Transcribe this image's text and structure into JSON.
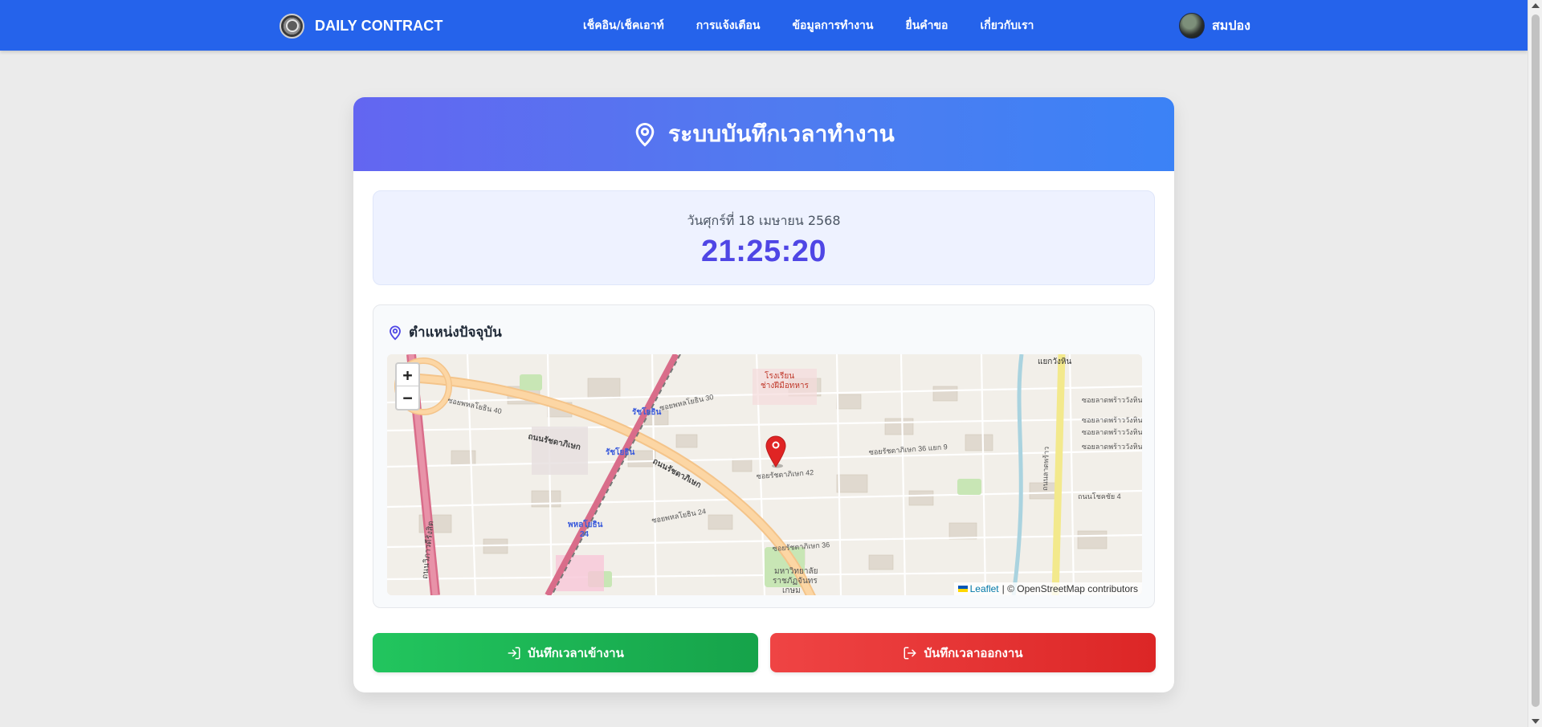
{
  "navbar": {
    "brand": "DAILY CONTRACT",
    "items": [
      {
        "label": "เช็คอิน/เช็คเอาท์"
      },
      {
        "label": "การแจ้งเตือน"
      },
      {
        "label": "ข้อมูลการทำงาน"
      },
      {
        "label": "ยื่นคำขอ"
      },
      {
        "label": "เกี่ยวกับเรา"
      }
    ],
    "user_name": "สมปอง"
  },
  "card": {
    "title": "ระบบบันทึกเวลาทำงาน",
    "date": "วันศุกร์ที่ 18 เมษายน 2568",
    "time": "21:25:20",
    "location_title": "ตำแหน่งปัจจุบัน",
    "map": {
      "zoom_in": "+",
      "zoom_out": "−",
      "leaflet_label": "Leaflet",
      "osm_attribution": "| © OpenStreetMap contributors",
      "labels": {
        "l1": "โรงเรียน",
        "l2": "ช่างฝีมือทหาร",
        "l3": "รัชโยธิน",
        "l4": "รัชโยธิน",
        "l5": "พหลโยธิน",
        "l6": "24",
        "l7": "ถนนรัชดาภิเษก",
        "l8": "ถนนรัชดาภิเษก",
        "l9": "ซอยพหลโยธิน 30",
        "l10": "ซอยรัชดาภิเษก 42",
        "l11": "ซอยรัชดาภิเษก 36",
        "l12": "ซอยพหลโยธิน 24",
        "l13": "มหาวิทยาลัย",
        "l14": "ราชภัฏจันทร",
        "l15": "เกษม",
        "l16": "แยกวังหิน",
        "l17": "ซอยลาดพร้าววังหิน 80",
        "l18": "ซอยลาดพร้าววังหิน 74",
        "l19": "ซอยลาดพร้าววังหิน 72",
        "l20": "ซอยลาดพร้าววังหิน 70",
        "l21": "ถนนโชคชัย 4",
        "l22": "ถนนประดิพัทธ์",
        "l23": "ถนนลาดพร้าว",
        "l24": "ซอยรัชดาภิเษก 36 แยก 9",
        "l25": "ซอยพหลโยธิน 40",
        "l26": "ถนนวิภาวดีรังสิต"
      }
    },
    "btn_checkin": "บันทึกเวลาเข้างาน",
    "btn_checkout": "บันทึกเวลาออกงาน"
  },
  "colors": {
    "navbar": "#2563eb",
    "header_start": "#6366f1",
    "header_end": "#3b82f6",
    "time": "#4f46e5",
    "checkin": "#22c55e",
    "checkout": "#ef4444",
    "marker": "#e02424"
  },
  "icons": {
    "location": "map-pin-icon",
    "checkin": "sign-in-icon",
    "checkout": "sign-out-icon",
    "marker": "map-marker-icon"
  }
}
